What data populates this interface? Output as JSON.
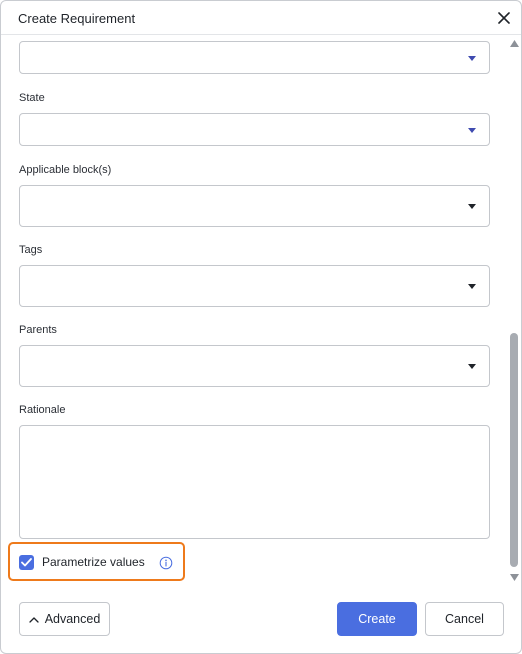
{
  "dialog": {
    "title": "Create Requirement"
  },
  "form": {
    "state_label": "State",
    "applicable_blocks_label": "Applicable block(s)",
    "tags_label": "Tags",
    "parents_label": "Parents",
    "rationale_label": "Rationale",
    "parametrize_label": "Parametrize values",
    "parametrize_checked": true
  },
  "footer": {
    "advanced_label": "Advanced",
    "create_label": "Create",
    "cancel_label": "Cancel"
  },
  "colors": {
    "accent": "#4a6ee0",
    "highlight": "#ee7a1b"
  },
  "icons": [
    "close-icon",
    "chevron-down-icon",
    "check-icon",
    "info-icon",
    "chevron-up-icon"
  ]
}
